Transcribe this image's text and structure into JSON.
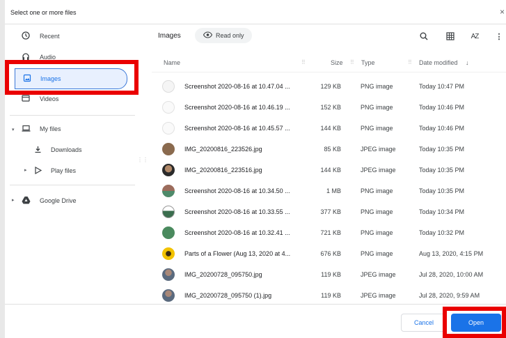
{
  "dialog": {
    "title": "Select one or more files",
    "close_glyph": "×"
  },
  "sidebar": {
    "items": [
      {
        "label": "Recent",
        "icon": "clock-icon"
      },
      {
        "label": "Audio",
        "icon": "headphones-icon"
      },
      {
        "label": "Images",
        "icon": "image-icon",
        "active": true
      },
      {
        "label": "Videos",
        "icon": "video-icon"
      },
      {
        "label": "My files",
        "icon": "laptop-icon"
      },
      {
        "label": "Downloads",
        "icon": "download-icon"
      },
      {
        "label": "Play files",
        "icon": "play-store-icon"
      },
      {
        "label": "Google Drive",
        "icon": "drive-icon"
      }
    ]
  },
  "toolbar": {
    "breadcrumb": "Images",
    "read_only": "Read only",
    "sort_az": "AZ"
  },
  "columns": {
    "name": "Name",
    "size": "Size",
    "type": "Type",
    "date": "Date modified"
  },
  "files": [
    {
      "name": "Screenshot 2020-08-16 at 10.47.04 ...",
      "size": "129 KB",
      "type": "PNG image",
      "date": "Today 10:47 PM"
    },
    {
      "name": "Screenshot 2020-08-16 at 10.46.19 ...",
      "size": "152 KB",
      "type": "PNG image",
      "date": "Today 10:46 PM"
    },
    {
      "name": "Screenshot 2020-08-16 at 10.45.57 ...",
      "size": "144 KB",
      "type": "PNG image",
      "date": "Today 10:46 PM"
    },
    {
      "name": "IMG_20200816_223526.jpg",
      "size": "85 KB",
      "type": "JPEG image",
      "date": "Today 10:35 PM"
    },
    {
      "name": "IMG_20200816_223516.jpg",
      "size": "144 KB",
      "type": "JPEG image",
      "date": "Today 10:35 PM"
    },
    {
      "name": "Screenshot 2020-08-16 at 10.34.50 ...",
      "size": "1 MB",
      "type": "PNG image",
      "date": "Today 10:35 PM"
    },
    {
      "name": "Screenshot 2020-08-16 at 10.33.55 ...",
      "size": "377 KB",
      "type": "PNG image",
      "date": "Today 10:34 PM"
    },
    {
      "name": "Screenshot 2020-08-16 at 10.32.41 ...",
      "size": "721 KB",
      "type": "PNG image",
      "date": "Today 10:32 PM"
    },
    {
      "name": "Parts of a Flower (Aug 13, 2020 at 4...",
      "size": "676 KB",
      "type": "PNG image",
      "date": "Aug 13, 2020, 4:15 PM"
    },
    {
      "name": "IMG_20200728_095750.jpg",
      "size": "119 KB",
      "type": "JPEG image",
      "date": "Jul 28, 2020, 10:00 AM"
    },
    {
      "name": "IMG_20200728_095750 (1).jpg",
      "size": "119 KB",
      "type": "JPEG image",
      "date": "Jul 28, 2020, 9:59 AM"
    }
  ],
  "footer": {
    "cancel": "Cancel",
    "open": "Open"
  },
  "colors": {
    "accent": "#1a73e8",
    "highlight": "#ea0000"
  }
}
